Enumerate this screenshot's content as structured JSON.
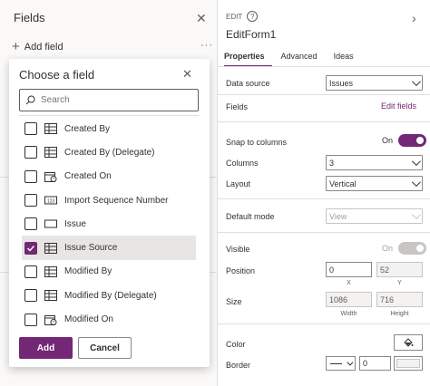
{
  "fields_pane": {
    "title": "Fields",
    "add_field_label": "Add field",
    "more_label": "···"
  },
  "popup": {
    "title": "Choose a field",
    "search_placeholder": "Search",
    "fields": [
      {
        "label": "Created By",
        "icon": "table-icon",
        "checked": false
      },
      {
        "label": "Created By (Delegate)",
        "icon": "table-icon",
        "checked": false
      },
      {
        "label": "Created On",
        "icon": "calendar-clock-icon",
        "checked": false
      },
      {
        "label": "Import Sequence Number",
        "icon": "number-icon",
        "checked": false
      },
      {
        "label": "Issue",
        "icon": "text-field-icon",
        "checked": false
      },
      {
        "label": "Issue Source",
        "icon": "table-icon",
        "checked": true
      },
      {
        "label": "Modified By",
        "icon": "table-icon",
        "checked": false
      },
      {
        "label": "Modified By (Delegate)",
        "icon": "table-icon",
        "checked": false
      },
      {
        "label": "Modified On",
        "icon": "calendar-clock-icon",
        "checked": false
      }
    ],
    "add_label": "Add",
    "cancel_label": "Cancel"
  },
  "props": {
    "kind": "EDIT",
    "name": "EditForm1",
    "tabs": [
      "Properties",
      "Advanced",
      "Ideas"
    ],
    "active_tab": "Properties",
    "data_source_label": "Data source",
    "data_source_value": "Issues",
    "fields_label": "Fields",
    "edit_fields_link": "Edit fields",
    "snap_label": "Snap to columns",
    "snap_state": "On",
    "columns_label": "Columns",
    "columns_value": "3",
    "layout_label": "Layout",
    "layout_value": "Vertical",
    "default_mode_label": "Default mode",
    "default_mode_value": "View",
    "visible_label": "Visible",
    "visible_state": "On",
    "position_label": "Position",
    "position_x": "0",
    "position_y": "52",
    "x_label": "X",
    "y_label": "Y",
    "size_label": "Size",
    "size_width": "1086",
    "size_height": "716",
    "width_label": "Width",
    "height_label": "Height",
    "color_label": "Color",
    "border_label": "Border",
    "border_width": "0"
  },
  "colors": {
    "accent": "#742774",
    "selected_row": "#e8e6e4"
  }
}
